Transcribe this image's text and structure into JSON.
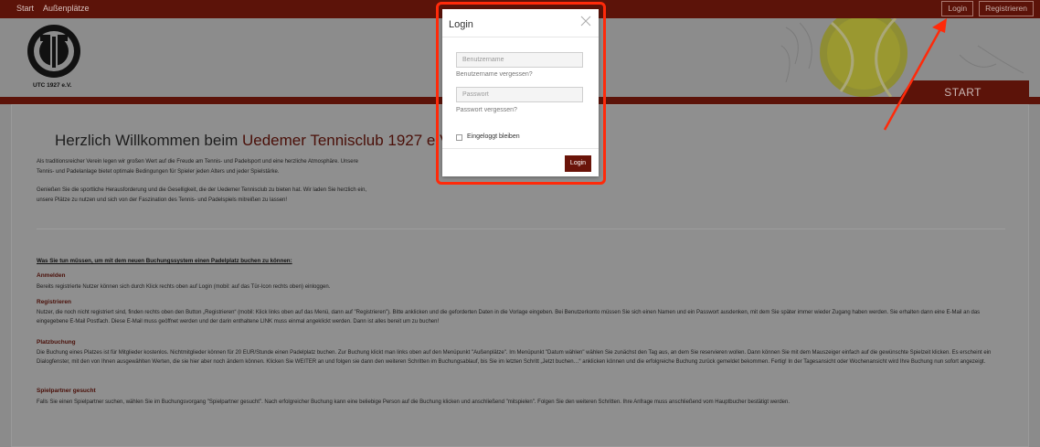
{
  "topnav": {
    "left": [
      "Start",
      "Außenplätze"
    ],
    "login": "Login",
    "register": "Registrieren"
  },
  "header": {
    "logo_text": "UTC 1927 e.V.",
    "banner": "START"
  },
  "welcome": {
    "prefix": "Herzlich Willkommen beim ",
    "club": "Uedemer Tennisclub 1927 e.V."
  },
  "intro": {
    "p1a": "Als traditionsreicher Verein legen wir großen Wert auf die Freude am Tennis- und Padelsport und eine herzliche Atmosphäre. Unsere",
    "p1b": "Tennis- und Padelanlage bietet optimale Bedingungen für Spieler jeden Alters und jeder Spielstärke.",
    "p2a": "Genießen Sie die sportliche Herausforderung und die Geselligkeit, die der Uedemer Tennisclub zu bieten hat. Wir laden Sie herzlich ein,",
    "p2b": "unsere Plätze zu nutzen und sich von der Faszination des Tennis- und Padelspiels mitreißen zu lassen!"
  },
  "guide": {
    "heading": "Was Sie tun müssen, um mit dem neuen Buchungssystem einen Padelplatz buchen zu können:",
    "sections": [
      {
        "title": "Anmelden",
        "text": "Bereits registrierte Nutzer können sich durch Klick rechts oben auf Login (mobil: auf das Tür-Icon rechts oben) einloggen."
      },
      {
        "title": "Registrieren",
        "text": "Nutzer, die noch nicht registriert sind, finden rechts oben den Button „Registrieren“ (mobil: Klick links oben auf das Menü, dann auf \"Registrieren\"). Bitte anklicken und die geforderten Daten in die Vorlage eingeben. Bei Benutzerkonto müssen Sie sich einen Namen und ein Passwort ausdenken, mit dem Sie später immer wieder Zugang haben werden. Sie erhalten dann eine E-Mail an das eingegebene E-Mail Postfach. Diese E-Mail muss geöffnet werden und der darin enthaltene LINK muss einmal angeklickt werden. Dann ist alles bereit um zu buchen!"
      },
      {
        "title": "Platzbuchung",
        "text": "Die Buchung eines Platzes ist für Mitglieder kostenlos. Nichtmitglieder können für 20 EUR/Stunde einen Padelplatz buchen. Zur Buchung klickt man links oben auf den Menüpunkt \"Außenplätze\". Im Menüpunkt \"Datum wählen\" wählen Sie zunächst den Tag aus, an dem Sie reservieren wollen. Dann können Sie mit dem Mauszeiger einfach auf die gewünschte Spielzeit klicken. Es erscheint ein Dialogfenster, mit den von Ihnen ausgewählten Werten, die sie hier aber noch ändern können. Klicken Sie WEITER an und folgen sie dann den weiteren  Schritten im Buchungsablauf, bis Sie im letzten Schritt „Jetzt buchen…“ anklicken können und die erfolgreiche Buchung zurück gemeldet bekommen. Fertig! In der Tagesansicht oder Wochenansicht wird Ihre Buchung nun sofort angezeigt."
      },
      {
        "title": "Spielpartner gesucht",
        "text": "Falls Sie einen Spielpartner suchen, wählen Sie im Buchungsvorgang \"Spielpartner gesucht\". Nach erfolgreicher Buchung kann eine beliebige Person auf die Buchung klicken und anschließend \"mitspielen\". Folgen Sie den weiteren Schritten. Ihre Anfrage muss anschließend vom Hauptbucher bestätigt werden."
      }
    ]
  },
  "modal": {
    "title": "Login",
    "username_placeholder": "Benutzername",
    "forgot_username": "Benutzername vergessen?",
    "password_placeholder": "Passwort",
    "forgot_password": "Passwort vergessen?",
    "remember_label": "Eingeloggt bleiben",
    "submit": "Login"
  },
  "colors": {
    "brand": "#5c1309",
    "highlight": "#ff2a0a"
  }
}
